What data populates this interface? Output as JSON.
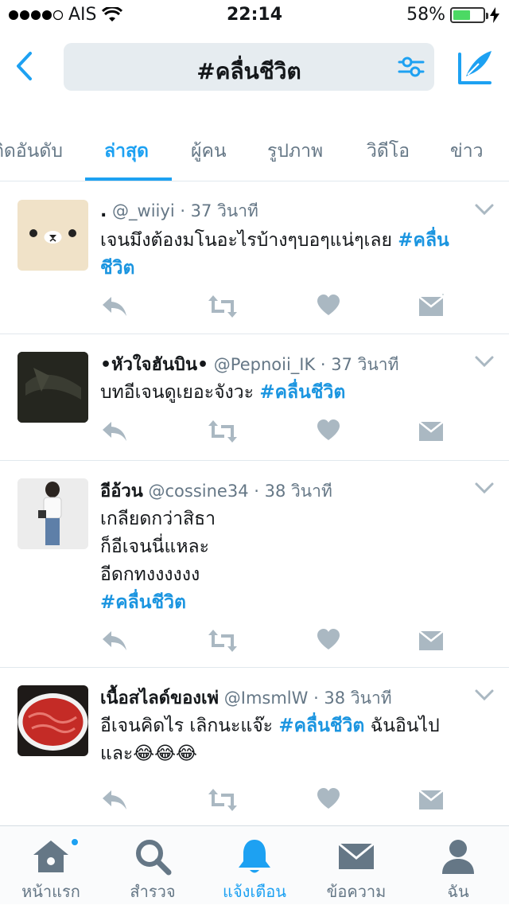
{
  "status_bar": {
    "carrier": "AIS",
    "time": "22:14",
    "battery": "58%",
    "battery_level": 0.58
  },
  "search": {
    "query": "#คลื่นชีวิต"
  },
  "tabs": [
    {
      "label": "ติดอันดับ"
    },
    {
      "label": "ล่าสุด"
    },
    {
      "label": "ผู้คน"
    },
    {
      "label": "รูปภาพ"
    },
    {
      "label": "วิดีโอ"
    },
    {
      "label": "ข่าว"
    }
  ],
  "active_tab": "ล่าสุด",
  "tweets": [
    {
      "name": ".",
      "handle": "@_wiiyi · 37 วินาที",
      "text": "เจนมึงต้องมโนอะไรบ้างๆบอๆแน่ๆเลย",
      "hashtag": "#คลื่นชีวิต",
      "text_after": "",
      "avatar_icon": "bear-avatar-icon"
    },
    {
      "name": "•หัวใจฮันบิน•",
      "handle": "@Pepnoii_IK · 37 วินาที",
      "text": "บทอีเจนดูเยอะจังวะ",
      "hashtag": "#คลื่นชีวิต",
      "text_after": "",
      "avatar_icon": "dark-photo-avatar-icon"
    },
    {
      "name": "อีอ้วน",
      "handle": "@cossine34 · 38 วินาที",
      "lines": [
        "เกลียดกว่าสิธา",
        "ก็อีเจนนี่แหละ",
        "อีดกทงงงงงง"
      ],
      "hashtag": "#คลื่นชีวิต",
      "avatar_icon": "girl-photo-avatar-icon"
    },
    {
      "name": "เนื้อสไลด์ของเพ่",
      "handle": "@ImsmlW · 38 วินาที",
      "text": "อีเจนคิดไร เลิกนะแจ๊ะ",
      "hashtag": "#คลื่นชีวิต",
      "text_after": "ฉันอินไป",
      "line2": "และ😂😂😂",
      "avatar_icon": "sliced-beef-avatar-icon"
    }
  ],
  "bottom_nav": [
    {
      "label": "หน้าแรก",
      "icon": "home-icon"
    },
    {
      "label": "สำรวจ",
      "icon": "search-icon"
    },
    {
      "label": "แจ้งเตือน",
      "icon": "bell-icon"
    },
    {
      "label": "ข้อความ",
      "icon": "envelope-icon"
    },
    {
      "label": "ฉัน",
      "icon": "person-icon"
    }
  ],
  "active_nav": "แจ้งเตือน",
  "colors": {
    "accent": "#1da1f2",
    "hashtag": "#1b95e0",
    "muted": "#657786",
    "icon_gray": "#aab8c2"
  }
}
